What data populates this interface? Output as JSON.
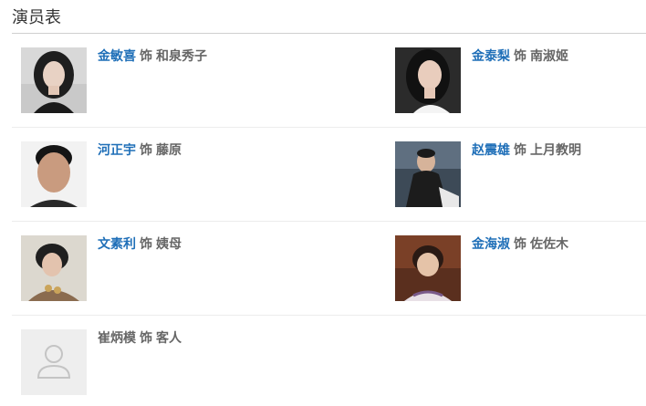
{
  "section": {
    "title": "演员表"
  },
  "as_word": "饰",
  "cast": [
    {
      "actor": "金敏喜",
      "role": "和泉秀子",
      "linked": true
    },
    {
      "actor": "金泰梨",
      "role": "南淑姬",
      "linked": true
    },
    {
      "actor": "河正宇",
      "role": "藤原",
      "linked": true
    },
    {
      "actor": "赵震雄",
      "role": "上月教明",
      "linked": true
    },
    {
      "actor": "文素利",
      "role": "姨母",
      "linked": true
    },
    {
      "actor": "金海淑",
      "role": "佐佐木",
      "linked": true
    },
    {
      "actor": "崔炳模",
      "role": "客人",
      "linked": false
    }
  ]
}
